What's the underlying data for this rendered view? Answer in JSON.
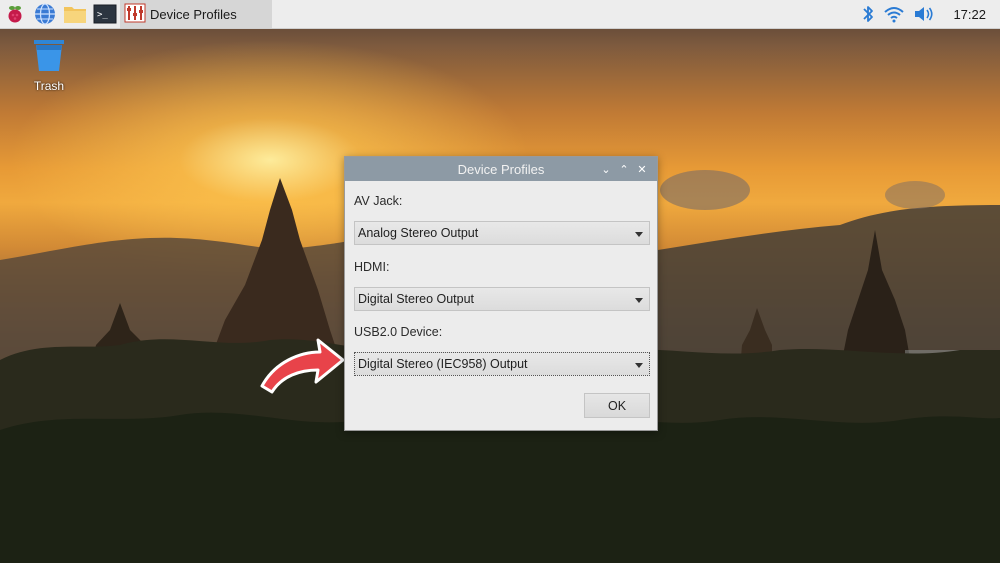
{
  "taskbar": {
    "launchers": [
      "raspberry-menu-icon",
      "web-browser-icon",
      "file-manager-icon",
      "terminal-icon"
    ],
    "task_label": "Device Profiles",
    "clock": "17:22",
    "tray_icons": [
      "bluetooth-icon",
      "wifi-icon",
      "volume-icon"
    ]
  },
  "desktop": {
    "trash_label": "Trash"
  },
  "dialog": {
    "title": "Device Profiles",
    "fields": [
      {
        "label": "AV Jack:",
        "value": "Analog Stereo Output"
      },
      {
        "label": "HDMI:",
        "value": "Digital Stereo Output"
      },
      {
        "label": "USB2.0 Device:",
        "value": "Digital Stereo (IEC958) Output"
      }
    ],
    "ok_label": "OK"
  },
  "colors": {
    "titlebar": "#8d9aa5",
    "dialog_bg": "#ececec",
    "arrow": "#e8434a",
    "taskbar": "#ededed"
  }
}
